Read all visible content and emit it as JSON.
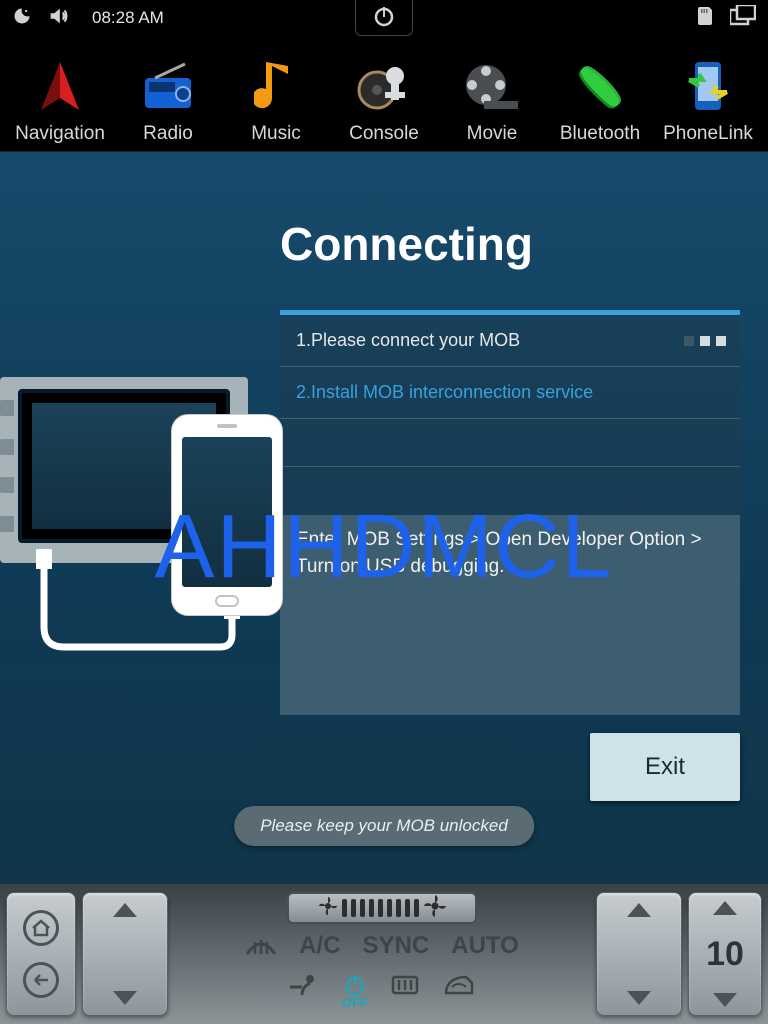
{
  "status": {
    "time": "08:28 AM"
  },
  "apps": {
    "navigation": "Navigation",
    "radio": "Radio",
    "music": "Music",
    "console": "Console",
    "movie": "Movie",
    "bluetooth": "Bluetooth",
    "phonelink": "PhoneLink"
  },
  "main": {
    "title": "Connecting",
    "step1": "1.Please connect your MOB",
    "step2": "2.Install MOB interconnection service",
    "instructions": "Enter MOB Settings > Open Developer Option > Turn on USB debugging.",
    "exit": "Exit",
    "hint": "Please keep your MOB unlocked"
  },
  "climate": {
    "ac": "A/C",
    "sync": "SYNC",
    "auto": "AUTO",
    "off": "OFF",
    "temp_right": "10"
  },
  "watermark": "AHHDMCL"
}
